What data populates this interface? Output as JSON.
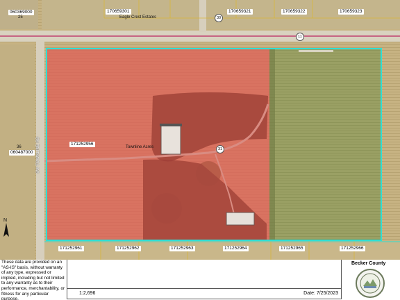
{
  "map": {
    "parcel_labels": {
      "top_left": "060369000",
      "top_left_num": "25",
      "top_1": "170659301",
      "top_2": "170659321",
      "top_3": "170659322",
      "top_4": "170659323",
      "left_num": "36",
      "left_parcel": "060487000",
      "center_parcel": "171252956",
      "bottom_1": "171252961",
      "bottom_2": "171252962",
      "bottom_3": "171252963",
      "bottom_4": "171252964",
      "bottom_5": "171252965",
      "bottom_6": "171252966"
    },
    "subdivisions": {
      "eagle_crest": "Eagle Crest Estates",
      "townline": "Townline Acres"
    },
    "routes": {
      "hwy_top_left": "30",
      "hwy_main": "11",
      "driveway_route": "31"
    },
    "road_name": "SW TOWNLINE RD",
    "north_label": "N",
    "colors": {
      "subject_highlight": "#e05a55",
      "parcel_outline": "#2ee0d6",
      "highway_line": "#c04070"
    }
  },
  "footer": {
    "disclaimer": "These data are provided on an \"AS-IS\" basis, without warranty of any type, expressed or implied, including but not limited to any warranty as to their performance, merchantability, or fitness for any particular purpose.",
    "scale": "1:2,696",
    "date": "Date: 7/25/2023",
    "county": "Becker County",
    "seal_icon": "county-seal-icon"
  }
}
